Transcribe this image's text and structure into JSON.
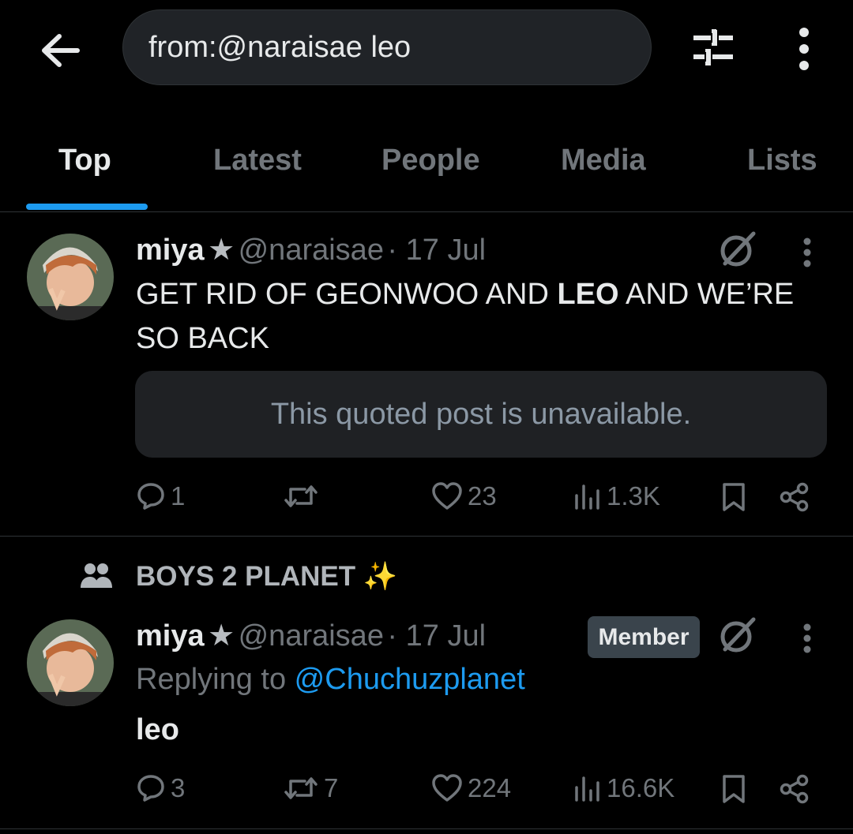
{
  "search": {
    "query": "from:@naraisae leo"
  },
  "tabs": [
    {
      "label": "Top",
      "active": true
    },
    {
      "label": "Latest",
      "active": false
    },
    {
      "label": "People",
      "active": false
    },
    {
      "label": "Media",
      "active": false
    },
    {
      "label": "Lists",
      "active": false
    }
  ],
  "colors": {
    "accent": "#1d9bf0",
    "background": "#000000",
    "muted": "#71767b"
  },
  "tweets": [
    {
      "name": "miya",
      "star": "★",
      "handle": "@naraisae",
      "date": "· 17 Jul",
      "text_before": "GET RID OF GEONWOO AND ",
      "text_bold": "LEO",
      "text_after": " AND WE’RE SO BACK",
      "quote_text": "This quoted post is unavailable.",
      "replies": "1",
      "retweets": "",
      "likes": "23",
      "views": "1.3K"
    },
    {
      "community": "BOYS 2 PLANET ✨",
      "name": "miya",
      "star": "★",
      "handle": "@naraisae",
      "date": "· 17 Jul",
      "badge": "Member",
      "replying_prefix": "Replying to ",
      "replying_to": "@Chuchuzplanet",
      "text": "leo",
      "replies": "3",
      "retweets": "7",
      "likes": "224",
      "views": "16.6K"
    }
  ]
}
